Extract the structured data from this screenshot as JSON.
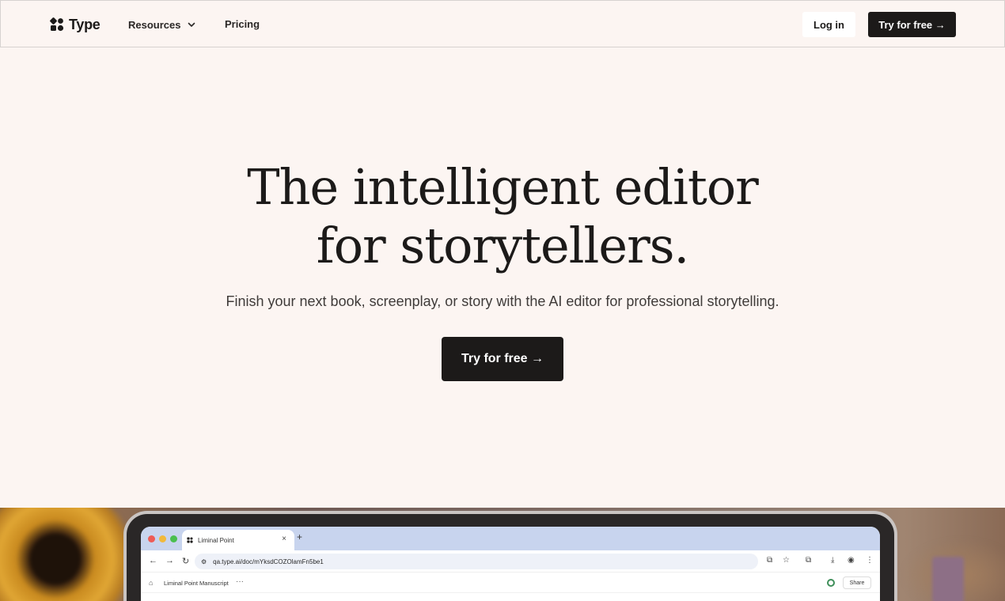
{
  "header": {
    "logo_text": "Type",
    "nav": {
      "resources_label": "Resources",
      "pricing_label": "Pricing"
    },
    "login_label": "Log in",
    "try_label": "Try for free →"
  },
  "hero": {
    "headline_line1": "The intelligent editor",
    "headline_line2": "for storytellers.",
    "subhead": "Finish your next book, screenplay, or story with the AI editor for professional storytelling.",
    "cta_label": "Try for free →"
  },
  "preview": {
    "tab_title": "Liminal Point",
    "tab_close": "×",
    "tab_new": "+",
    "url": "qa.type.ai/doc/mYksdCOZOlamFn5be1",
    "doc_title": "Liminal Point Manuscript",
    "doc_menu": "···",
    "share_label": "Share"
  },
  "colors": {
    "page_bg": "#fcf5f2",
    "primary_dark": "#1c1a19",
    "traffic_red": "#ee5b55",
    "traffic_yellow": "#f1b93b",
    "traffic_green": "#4bbf4f"
  },
  "icons": {
    "logo": "type-logo-icon",
    "resources_dropdown": "chevron-down-icon"
  }
}
